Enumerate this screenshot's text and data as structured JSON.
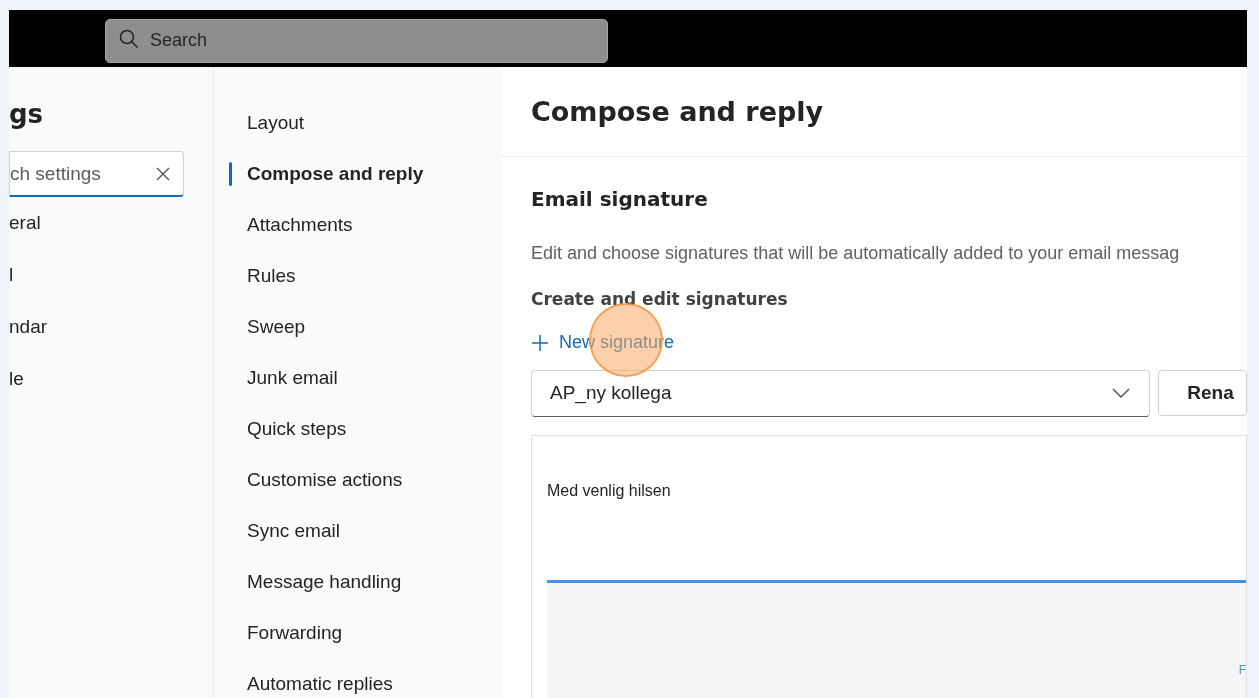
{
  "top_bar": {
    "search": {
      "placeholder": "Search"
    }
  },
  "settings_panel": {
    "title": "gs",
    "search": {
      "value": "ch settings"
    },
    "items": [
      {
        "label": "eral",
        "selected": false
      },
      {
        "label": "l",
        "selected": false
      },
      {
        "label": "ndar",
        "selected": false
      },
      {
        "label": "le",
        "selected": false
      }
    ]
  },
  "category_nav": {
    "items": [
      {
        "label": "Layout",
        "selected": false
      },
      {
        "label": "Compose and reply",
        "selected": true
      },
      {
        "label": "Attachments",
        "selected": false
      },
      {
        "label": "Rules",
        "selected": false
      },
      {
        "label": "Sweep",
        "selected": false
      },
      {
        "label": "Junk email",
        "selected": false
      },
      {
        "label": "Quick steps",
        "selected": false
      },
      {
        "label": "Customise actions",
        "selected": false
      },
      {
        "label": "Sync email",
        "selected": false
      },
      {
        "label": "Message handling",
        "selected": false
      },
      {
        "label": "Forwarding",
        "selected": false
      },
      {
        "label": "Automatic replies",
        "selected": false
      }
    ]
  },
  "content": {
    "title": "Compose and reply",
    "section_title": "Email signature",
    "description": "Edit and choose signatures that will be automatically added to your email messag",
    "subsection_title": "Create and edit signatures",
    "new_signature_link": "New signature",
    "signature_select": {
      "value": "AP_ny kollega"
    },
    "rename_button": "Rena",
    "editor": {
      "text": "Med venlig hilsen",
      "corner_text": "F"
    }
  }
}
